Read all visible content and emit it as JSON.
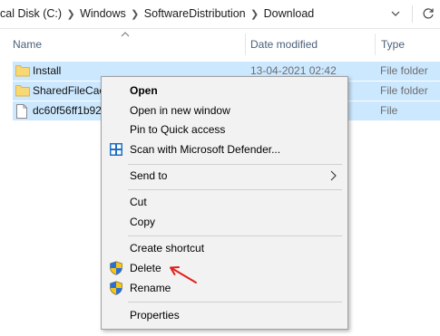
{
  "address": {
    "crumbs": [
      "cal Disk (C:)",
      "Windows",
      "SoftwareDistribution",
      "Download"
    ],
    "dropdown_icon": "chevron-down-icon",
    "refresh_icon": "refresh-icon"
  },
  "columns": {
    "name": "Name",
    "date": "Date modified",
    "type": "Type"
  },
  "rows": [
    {
      "name": "Install",
      "date": "13-04-2021 02:42",
      "type": "File folder",
      "icon": "folder-icon"
    },
    {
      "name": "SharedFileCac",
      "date": "",
      "type": "File folder",
      "icon": "folder-icon"
    },
    {
      "name": "dc60f56ff1b92",
      "date": "",
      "type": "File",
      "icon": "file-icon"
    }
  ],
  "menu": {
    "open": "Open",
    "open_new_window": "Open in new window",
    "pin_quick_access": "Pin to Quick access",
    "scan_defender": "Scan with Microsoft Defender...",
    "send_to": "Send to",
    "cut": "Cut",
    "copy": "Copy",
    "create_shortcut": "Create shortcut",
    "delete": "Delete",
    "rename": "Rename",
    "properties": "Properties"
  },
  "colors": {
    "selection": "#cce8ff",
    "menu_bg": "#f2f2f2",
    "arrow": "#e0201c",
    "folder": "#f8d775"
  }
}
